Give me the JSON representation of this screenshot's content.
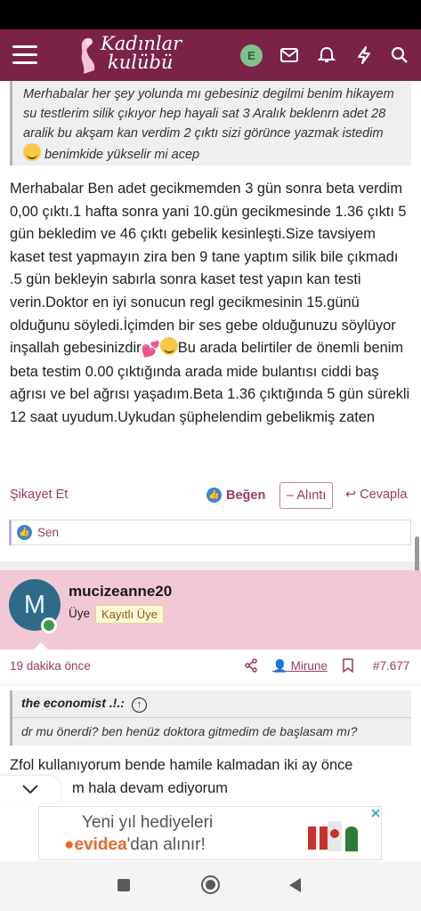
{
  "header": {
    "logo_line1": "Kadınlar",
    "logo_line2": "kulübü",
    "user_initial": "E",
    "brand_color": "#7a2346",
    "icons": [
      "menu-icon",
      "mail-icon",
      "bell-icon",
      "bolt-icon",
      "search-icon"
    ]
  },
  "post1": {
    "quote_text": "Merhabalar her şey yolunda mı gebesiniz degilmi benim hikayem su testlerim silik çıkıyor hep hayali sat 3 Aralık beklenrn adet 28 aralik bu akşam kan verdim 2 çıktı sizi görünce yazmak istedim",
    "quote_text_end": " benimkide yükselir mi acep",
    "body_part1": "Merhabalar Ben adet gecikmemden 3 gün sonra beta verdim 0,00 çıktı.1 hafta sonra yani 10.gün gecikmesinde 1.36 çıktı 5 gün bekledim ve 46 çıktı gebelik kesinleşti.Size tavsiyem kaset test yapmayın zira ben 9 tane yaptım silik bile çıkmadı .5 gün bekleyin sabırla sonra kaset test yapın kan testi verin.Doktor en iyi sonucun regl gecikmesinin 15.günü olduğunu söyledi.İçimden bir ses gebe olduğunuzu söylüyor inşallah gebesinizdir",
    "body_part2": "Bu arada belirtiler de önemli benim beta testim 0.00 çıktığında arada mide bulantısı ciddi baş ağrısı ve bel ağrısı yaşadım.Beta 1.36 çıktığında 5 gün sürekli 12 saat uyudum.Uykudan şüphelendim gebelikmiş zaten",
    "actions": {
      "report": "Şikayet Et",
      "like": "Beğen",
      "quote": "Alıntı",
      "reply": "Cevapla"
    },
    "reactions_text": "Sen"
  },
  "post2": {
    "avatar_initial": "M",
    "username": "mucizeanne20",
    "role": "Üye",
    "badge": "Kayıtlı Üye",
    "time": "19 dakika önce",
    "mention": "Mirune",
    "post_number": "#7.677",
    "quote_author": "the economist .!.:",
    "quote_text": "dr mu önerdi? ben henüz doktora gitmedim de başlasam mı?",
    "body_line1": "Zfol kullanıyorum bende hamile kalmadan iki ay önce",
    "body_line2": "m hala devam ediyorum"
  },
  "ad": {
    "line1": "Yeni yıl hediyeleri",
    "brand": "evidea",
    "line2_suffix": "'dan alınır!"
  }
}
